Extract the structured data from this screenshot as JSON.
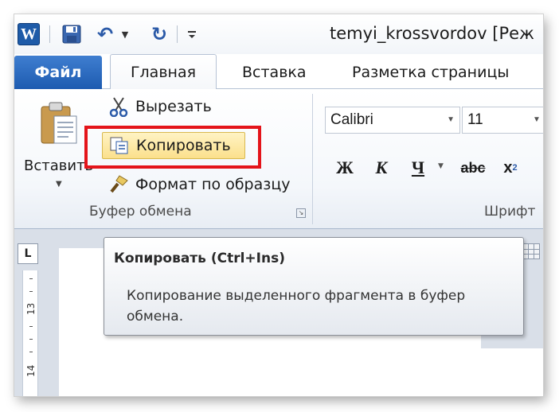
{
  "window": {
    "title": "temyi_krossvordov [Реж",
    "word_icon_letter": "W"
  },
  "tabs": {
    "file": "Файл",
    "home": "Главная",
    "insert": "Вставка",
    "layout": "Разметка страницы"
  },
  "clipboard": {
    "paste_label": "Вставить",
    "cut_label": "Вырезать",
    "copy_label": "Копировать",
    "format_painter_label": "Формат по образцу",
    "group_label": "Буфер обмена"
  },
  "font": {
    "name": "Calibri",
    "size": "11",
    "bold": "Ж",
    "italic": "К",
    "underline": "Ч",
    "strike": "abc",
    "subscript_base": "x",
    "subscript_sub": "2",
    "group_label": "Шрифт"
  },
  "ruler": {
    "corner": "L",
    "numbers": [
      "13",
      "14"
    ]
  },
  "tooltip": {
    "title": "Копировать (Ctrl+Ins)",
    "description": "Копирование выделенного фрагмента в буфер обмена."
  },
  "colors": {
    "file_tab": "#1d5bb0",
    "highlight": "#e4141a",
    "hover": "#fbe08c"
  }
}
